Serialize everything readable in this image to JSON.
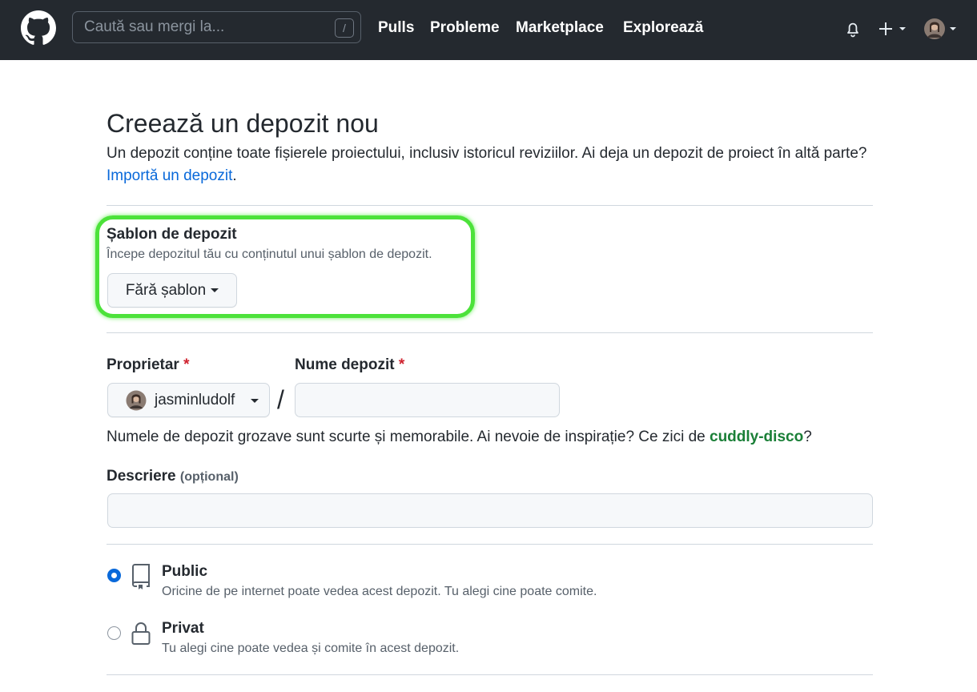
{
  "header": {
    "search_placeholder": "Caută sau mergi la...",
    "search_shortcut": "/",
    "nav": [
      "Pulls",
      "Probleme",
      "Marketplace",
      "Explorează"
    ]
  },
  "page": {
    "title": "Creează un depozit nou",
    "intro_text": "Un depozit conține toate fișierele proiectului, inclusiv istoricul reviziilor. Ai deja un depozit de proiect în altă parte?",
    "import_link": "Importă un depozit",
    "import_link_suffix": "."
  },
  "template": {
    "title": "Șablon de depozit",
    "description": "Începe depozitul tău cu conținutul unui șablon de depozit.",
    "selected": "Fără șablon"
  },
  "owner": {
    "label": "Proprietar",
    "required_mark": "*",
    "username": "jasminludolf"
  },
  "repo_name": {
    "label": "Nume depozit",
    "required_mark": "*",
    "separator": "/",
    "value": ""
  },
  "suggestion": {
    "text": "Numele de depozit grozave sunt scurte și memorabile. Ai nevoie de inspirație? Ce zici de",
    "name": "cuddly-disco",
    "suffix": "?"
  },
  "description": {
    "label": "Descriere",
    "optional": "(opțional)",
    "value": ""
  },
  "visibility": {
    "selected": "public",
    "options": [
      {
        "title": "Public",
        "description": "Oricine de pe internet poate vedea acest depozit. Tu alegi cine poate comite."
      },
      {
        "title": "Privat",
        "description": "Tu alegi cine poate vedea și comite în acest depozit."
      }
    ]
  },
  "colors": {
    "header_bg": "#24292f",
    "link": "#0969da",
    "highlight": "#4ce23a",
    "suggestion": "#1a7f37",
    "required": "#cf222e"
  }
}
